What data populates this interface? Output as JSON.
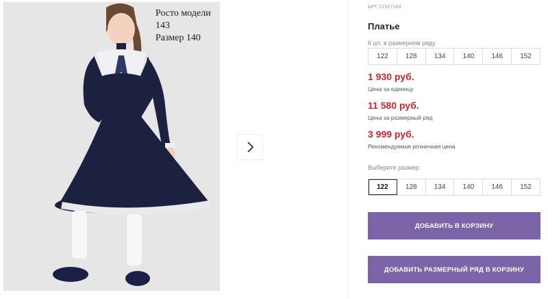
{
  "gallery": {
    "model_height": "Росто модели 143",
    "size": "Размер 140",
    "next_icon": "chevron-right-icon"
  },
  "product": {
    "article": "АРТ 22327168",
    "title": "Платье",
    "pack_label": "6 шт. в размерном ряду",
    "pack_sizes": [
      "122",
      "128",
      "134",
      "140",
      "146",
      "152"
    ],
    "unit_price": "1 930 руб.",
    "unit_price_note": "Цена за единицу",
    "pack_price": "11 580 руб.",
    "pack_price_note": "Цена за размерный ряд",
    "retail_price": "3 999 руб.",
    "retail_price_note": "Рекомендуемая розничная цена",
    "choose_size_label": "Выберите размер:",
    "sizes": [
      "122",
      "128",
      "134",
      "140",
      "146",
      "152"
    ],
    "selected_size": "122",
    "add_to_cart": "ДОБАВИТЬ В КОРЗИНУ",
    "add_pack_to_cart": "ДОБАВИТЬ РАЗМЕРНЫЙ РЯД В КОРЗИНУ"
  },
  "colors": {
    "price_red": "#d8232a",
    "button_purple": "#7c64a8"
  }
}
